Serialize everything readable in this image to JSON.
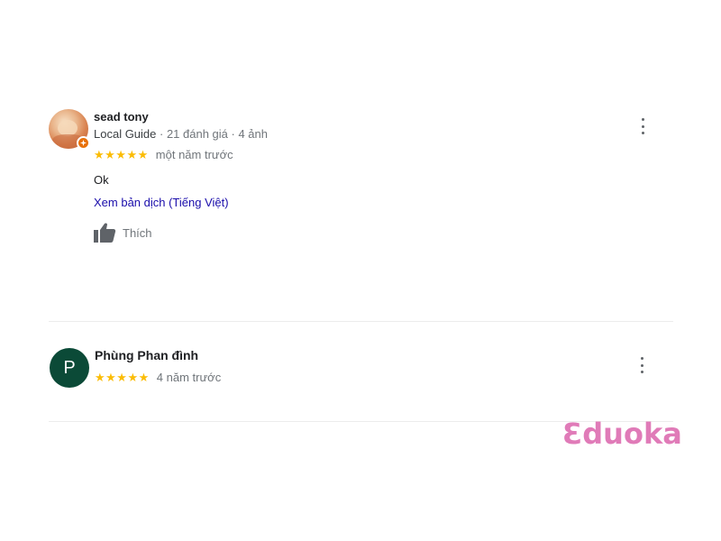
{
  "reviews": [
    {
      "author": "sead tony",
      "author_meta_guide": "Local Guide",
      "author_meta_stats": " · 21 đánh giá · 4 ảnh",
      "stars": "★★★★★",
      "rating": 5,
      "date": "một năm trước",
      "text": "Ok",
      "translate_link": "Xem bản dịch (Tiếng Việt)",
      "like_label": "Thích",
      "avatar_icon": "profile-photo",
      "badge_icon": "local-guide-badge-icon"
    },
    {
      "author": "Phùng Phan đình",
      "avatar_letter": "P",
      "stars": "★★★★★",
      "rating": 5,
      "date": "4 năm trước"
    }
  ],
  "watermark": "Ɛduoka",
  "colors": {
    "star": "#fbbc04",
    "link": "#1a0dab",
    "avatar_bg": "#0b4a37",
    "badge": "#e8710a",
    "watermark": "#e07bb8"
  }
}
